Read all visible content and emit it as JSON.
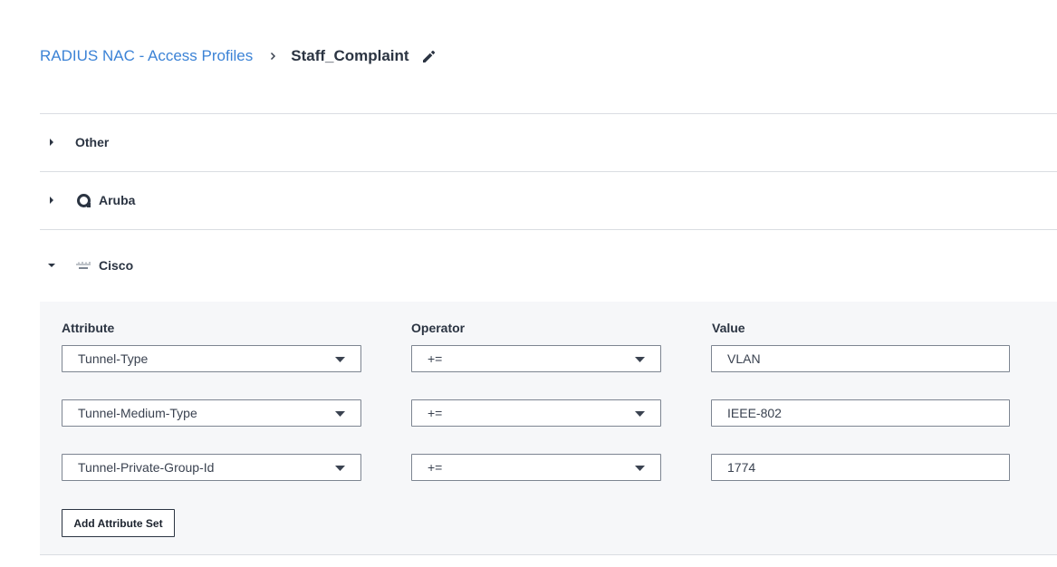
{
  "breadcrumb": {
    "parent": "RADIUS NAC - Access Profiles",
    "separator_icon": "chevron-right-icon",
    "current": "Staff_Complaint",
    "edit_icon": "pencil-icon"
  },
  "sections": [
    {
      "label": "Other",
      "expanded": false,
      "logo": null
    },
    {
      "label": "Aruba",
      "expanded": false,
      "logo": "aruba-logo"
    },
    {
      "label": "Cisco",
      "expanded": true,
      "logo": "cisco-logo"
    }
  ],
  "cisco_panel": {
    "headers": {
      "attribute": "Attribute",
      "operator": "Operator",
      "value": "Value"
    },
    "rows": [
      {
        "attribute": "Tunnel-Type",
        "operator": "+=",
        "value": "VLAN"
      },
      {
        "attribute": "Tunnel-Medium-Type",
        "operator": "+=",
        "value": "IEEE-802"
      },
      {
        "attribute": "Tunnel-Private-Group-Id",
        "operator": "+=",
        "value": "1774"
      }
    ],
    "add_button": "Add Attribute Set"
  },
  "colors": {
    "link": "#3c83d6",
    "text": "#2b3442",
    "panel_bg": "#f6f7f9",
    "divider": "#dadde2"
  }
}
